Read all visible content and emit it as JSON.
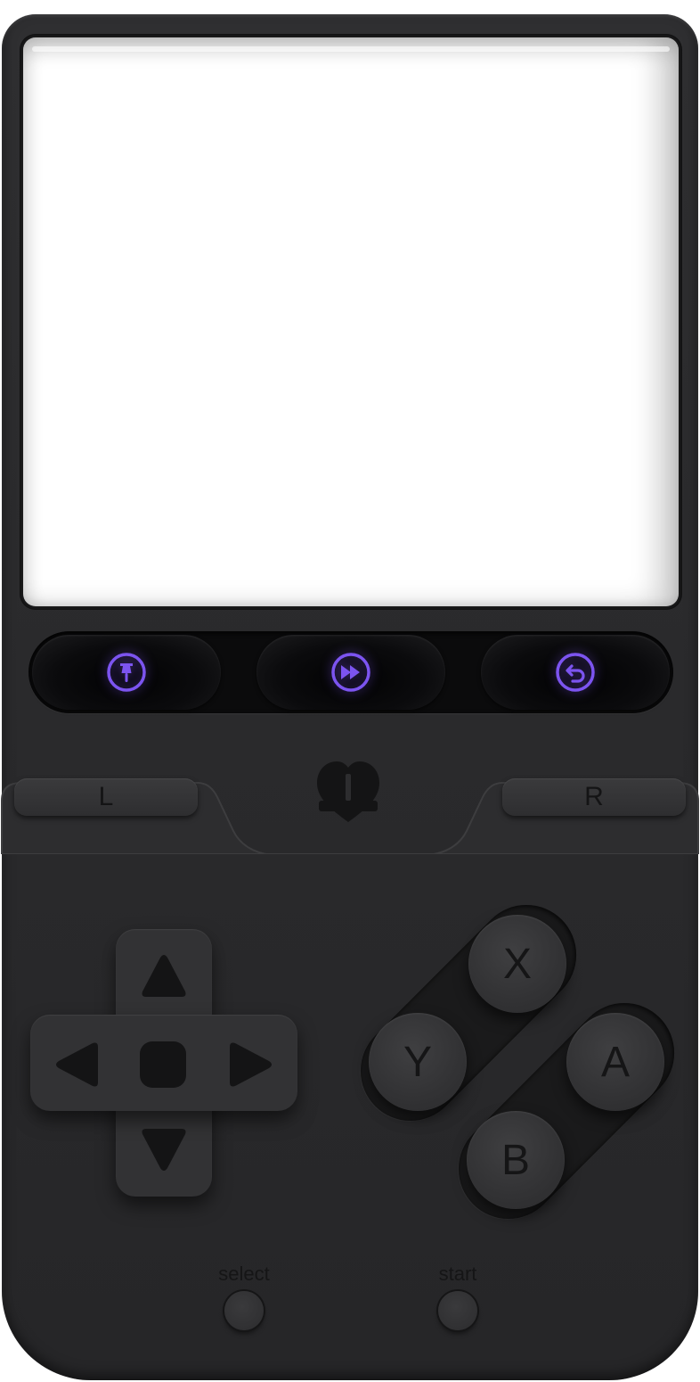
{
  "controls": {
    "actions": [
      {
        "icon": "pin-icon"
      },
      {
        "icon": "fast-forward-icon"
      },
      {
        "icon": "undo-icon"
      }
    ],
    "accent_color": "#7c54f0",
    "logo_icon": "heart-logo-icon",
    "shoulder": {
      "left_label": "L",
      "right_label": "R"
    },
    "dpad_icons": [
      "up-arrow-icon",
      "down-arrow-icon",
      "left-arrow-icon",
      "right-arrow-icon"
    ],
    "face_buttons": {
      "x": "X",
      "y": "Y",
      "a": "A",
      "b": "B"
    },
    "system": {
      "select_label": "select",
      "start_label": "start"
    }
  }
}
